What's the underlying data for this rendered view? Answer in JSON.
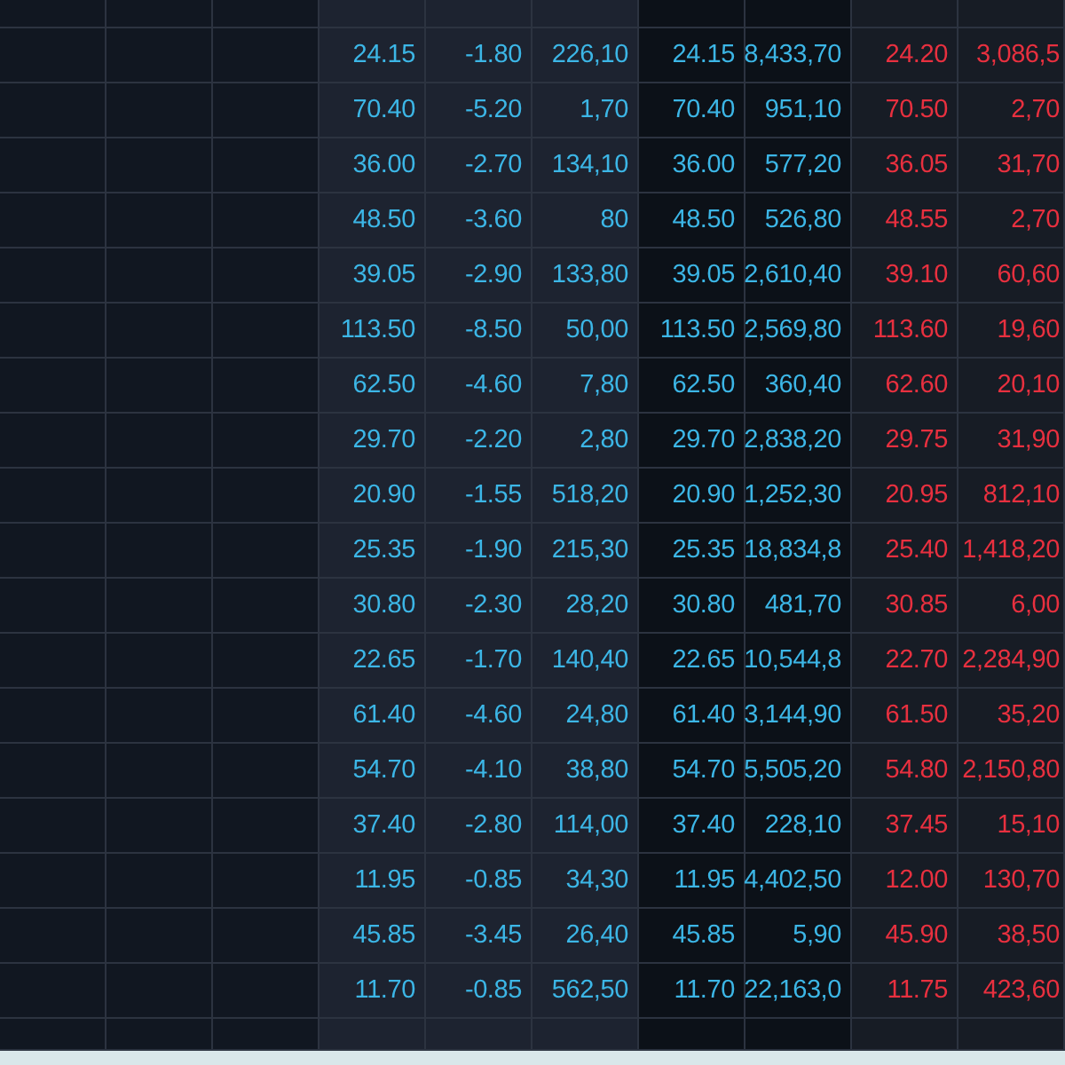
{
  "table": {
    "rows": [
      {
        "cells": [
          "24.15",
          "-1.80",
          "226,10",
          "24.15",
          "8,433,70",
          "24.20",
          "3,086,5"
        ]
      },
      {
        "cells": [
          "70.40",
          "-5.20",
          "1,70",
          "70.40",
          "951,10",
          "70.50",
          "2,70"
        ]
      },
      {
        "cells": [
          "36.00",
          "-2.70",
          "134,10",
          "36.00",
          "577,20",
          "36.05",
          "31,70"
        ]
      },
      {
        "cells": [
          "48.50",
          "-3.60",
          "80",
          "48.50",
          "526,80",
          "48.55",
          "2,70"
        ]
      },
      {
        "cells": [
          "39.05",
          "-2.90",
          "133,80",
          "39.05",
          "2,610,40",
          "39.10",
          "60,60"
        ]
      },
      {
        "cells": [
          "113.50",
          "-8.50",
          "50,00",
          "113.50",
          "2,569,80",
          "113.60",
          "19,60"
        ]
      },
      {
        "cells": [
          "62.50",
          "-4.60",
          "7,80",
          "62.50",
          "360,40",
          "62.60",
          "20,10"
        ]
      },
      {
        "cells": [
          "29.70",
          "-2.20",
          "2,80",
          "29.70",
          "2,838,20",
          "29.75",
          "31,90"
        ]
      },
      {
        "cells": [
          "20.90",
          "-1.55",
          "518,20",
          "20.90",
          "1,252,30",
          "20.95",
          "812,10"
        ]
      },
      {
        "cells": [
          "25.35",
          "-1.90",
          "215,30",
          "25.35",
          "18,834,8",
          "25.40",
          "1,418,20"
        ]
      },
      {
        "cells": [
          "30.80",
          "-2.30",
          "28,20",
          "30.80",
          "481,70",
          "30.85",
          "6,00"
        ]
      },
      {
        "cells": [
          "22.65",
          "-1.70",
          "140,40",
          "22.65",
          "10,544,8",
          "22.70",
          "2,284,90"
        ]
      },
      {
        "cells": [
          "61.40",
          "-4.60",
          "24,80",
          "61.40",
          "3,144,90",
          "61.50",
          "35,20"
        ]
      },
      {
        "cells": [
          "54.70",
          "-4.10",
          "38,80",
          "54.70",
          "5,505,20",
          "54.80",
          "2,150,80"
        ]
      },
      {
        "cells": [
          "37.40",
          "-2.80",
          "114,00",
          "37.40",
          "228,10",
          "37.45",
          "15,10"
        ]
      },
      {
        "cells": [
          "11.95",
          "-0.85",
          "34,30",
          "11.95",
          "4,402,50",
          "12.00",
          "130,70"
        ]
      },
      {
        "cells": [
          "45.85",
          "-3.45",
          "26,40",
          "45.85",
          "5,90",
          "45.90",
          "38,50"
        ]
      },
      {
        "cells": [
          "11.70",
          "-0.85",
          "562,50",
          "11.70",
          "22,163,0",
          "11.75",
          "423,60"
        ]
      }
    ]
  }
}
